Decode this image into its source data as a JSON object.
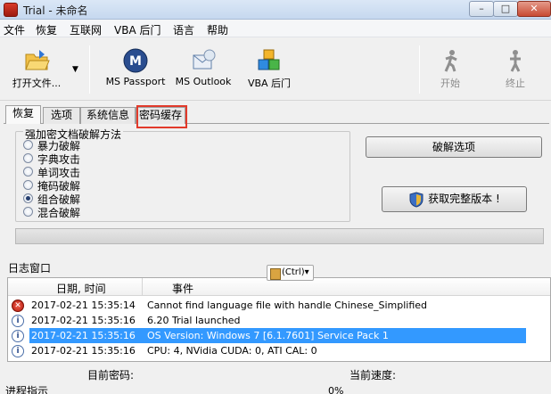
{
  "window": {
    "title": "Trial - 未命名",
    "min": "–",
    "max": "□",
    "close": "✕"
  },
  "menu": [
    "文件",
    "恢复",
    "互联网",
    "VBA 后门",
    "语言",
    "帮助"
  ],
  "toolbar": {
    "open": "打开文件...",
    "ms_passport": "MS Passport",
    "ms_outlook": "MS Outlook",
    "vba_backdoor": "VBA 后门",
    "start": "开始",
    "stop": "终止"
  },
  "tabs": [
    "恢复",
    "选项",
    "系统信息",
    "密码缓存"
  ],
  "recovery": {
    "group_title": "强加密文档破解方法",
    "methods": [
      "暴力破解",
      "字典攻击",
      "单词攻击",
      "掩码破解",
      "组合破解",
      "混合破解"
    ],
    "selected_method": "组合破解",
    "crack_options_button": "破解选项",
    "get_full_button": "获取完整版本 !"
  },
  "log": {
    "title": "日志窗口",
    "ctrl_badge": "(Ctrl)▾",
    "col_date": "日期, 时间",
    "col_event": "事件",
    "rows": [
      {
        "type": "error",
        "date": "2017-02-21 15:35:14",
        "event": "Cannot find language file with handle Chinese_Simplified"
      },
      {
        "type": "info",
        "date": "2017-02-21 15:35:16",
        "event": "6.20 Trial launched"
      },
      {
        "type": "info",
        "date": "2017-02-21 15:35:16",
        "event": "OS Version: Windows 7 [6.1.7601] Service Pack 1",
        "selected": true
      },
      {
        "type": "info",
        "date": "2017-02-21 15:35:16",
        "event": "CPU: 4, NVidia CUDA: 0, ATI CAL: 0"
      }
    ]
  },
  "status": {
    "current_password_label": "目前密码:",
    "current_speed_label": "当前速度:",
    "progress_label": "进程指示",
    "progress_percent": "0%"
  },
  "colors": {
    "accent": "#3399ff",
    "highlight_border": "#e23a2b"
  }
}
